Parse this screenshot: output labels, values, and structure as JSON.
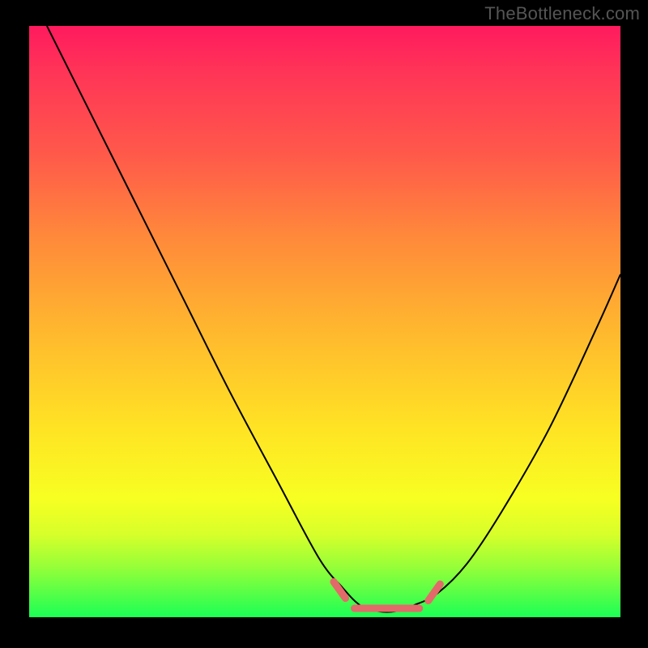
{
  "watermark": {
    "text": "TheBottleneck.com"
  },
  "colors": {
    "frame": "#000000",
    "curve": "#000000",
    "dash": "#e36a6a",
    "gradient_stops": [
      "#ff1a5e",
      "#ff3557",
      "#ff5a4a",
      "#ff8a3a",
      "#ffb92e",
      "#ffe324",
      "#f7ff22",
      "#d7ff2a",
      "#8fff3a",
      "#1bff55"
    ]
  },
  "chart_data": {
    "type": "line",
    "title": "",
    "xlabel": "",
    "ylabel": "",
    "xlim": [
      0,
      100
    ],
    "ylim": [
      0,
      100
    ],
    "grid": false,
    "legend": false,
    "series": [
      {
        "name": "curve",
        "x": [
          3,
          10,
          18,
          26,
          34,
          42,
          49,
          53,
          56,
          59,
          62,
          65,
          69,
          74,
          80,
          88,
          96,
          100
        ],
        "y": [
          100,
          86,
          70,
          54,
          38,
          23,
          10,
          5,
          2,
          1,
          1,
          2,
          4,
          9,
          18,
          32,
          49,
          58
        ]
      }
    ],
    "highlight_dashes": {
      "name": "bottom-highlight",
      "color": "#e36a6a",
      "segments": [
        {
          "x": [
            51.5,
            53.5
          ],
          "y": [
            6.0,
            3.2
          ]
        },
        {
          "x": [
            55.0,
            66.0
          ],
          "y": [
            1.5,
            1.5
          ]
        },
        {
          "x": [
            67.5,
            69.5
          ],
          "y": [
            2.8,
            5.6
          ]
        }
      ]
    },
    "annotations": []
  }
}
